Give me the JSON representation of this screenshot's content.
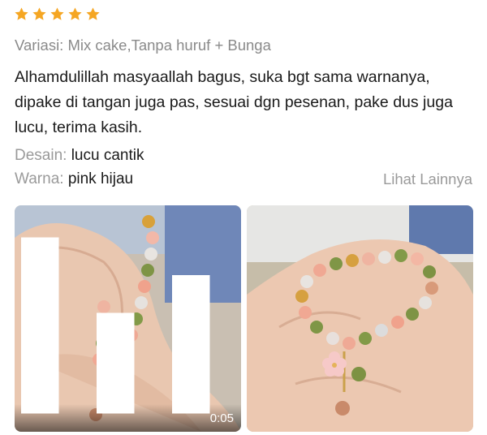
{
  "rating": {
    "stars": 5,
    "max": 5,
    "color": "#f5a623",
    "icon": "star-icon"
  },
  "variant": {
    "label": "Variasi:",
    "value": "Mix cake,Tanpa huruf + Bunga"
  },
  "review_text": "Alhamdulillah masyaallah bagus, suka bgt sama warnanya, dipake di tangan juga pas, sesuai dgn pesenan, pake dus juga lucu, terima kasih.",
  "attributes": {
    "design": {
      "label": "Desain:",
      "value": "lucu cantik"
    },
    "color": {
      "label": "Warna:",
      "value": "pink hijau"
    }
  },
  "see_more": "Lihat Lainnya",
  "media": {
    "video": {
      "duration": "0:05",
      "icon": "video-bars-icon"
    },
    "photo": {}
  }
}
